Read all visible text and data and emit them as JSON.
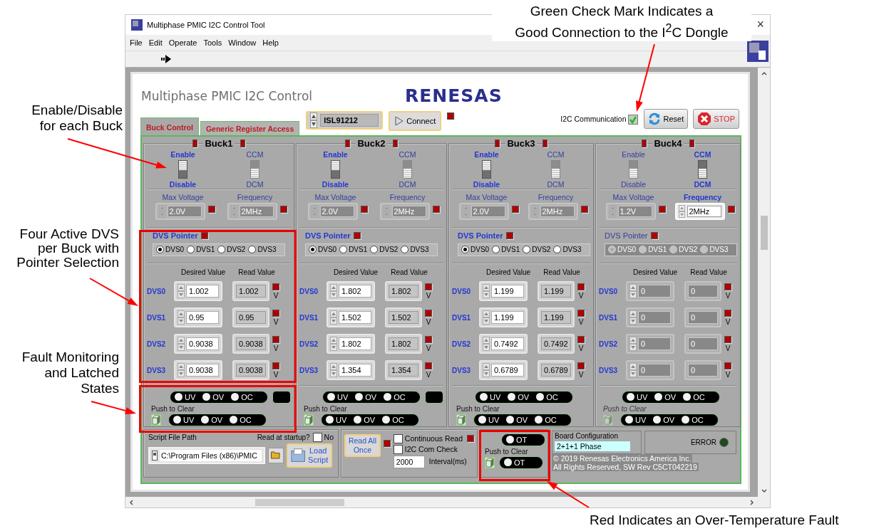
{
  "window": {
    "title": "Multiphase PMIC I2C Control Tool",
    "close": "×"
  },
  "menu": [
    "File",
    "Edit",
    "Operate",
    "Tools",
    "Window",
    "Help"
  ],
  "app": {
    "title": "Multiphase PMIC I2C Control",
    "logo": "RENESAS"
  },
  "tabs": [
    {
      "label": "Buck Control",
      "selected": true
    },
    {
      "label": "Generic Register Access",
      "selected": false
    }
  ],
  "device": {
    "value": "ISL91212"
  },
  "connect": {
    "label": "Connect"
  },
  "i2c": {
    "label": "I2C Communication",
    "checked": true
  },
  "reset": {
    "label": "Reset"
  },
  "stop": {
    "label": "STOP"
  },
  "bucks": [
    {
      "name": "Buck1",
      "switches": [
        {
          "top": "Enable",
          "bottom": "Disable",
          "on": true,
          "disabled": false
        },
        {
          "top": "CCM",
          "bottom": "DCM",
          "on": false,
          "disabled": true
        }
      ],
      "settings": [
        {
          "label": "Max Voltage",
          "value": "2.0V",
          "disabled": true
        },
        {
          "label": "Frequency",
          "value": "2MHz",
          "disabled": true
        }
      ],
      "dvs_pointer": {
        "label": "DVS Pointer",
        "disabled": false,
        "options": [
          {
            "label": "DVS0",
            "selected": true
          },
          {
            "label": "DVS1",
            "selected": false
          },
          {
            "label": "DVS2",
            "selected": false
          },
          {
            "label": "DVS3",
            "selected": false
          }
        ]
      },
      "dvs_table": {
        "disabled": false,
        "columns": [
          "Desired Value",
          "Read Value"
        ],
        "rows": [
          {
            "label": "DVS0",
            "desired": "1.002",
            "read": "1.002",
            "unit": "V"
          },
          {
            "label": "DVS1",
            "desired": "0.95",
            "read": "0.95",
            "unit": "V"
          },
          {
            "label": "DVS2",
            "desired": "0.9038",
            "read": "0.9038",
            "unit": "V"
          },
          {
            "label": "DVS3",
            "desired": "0.9038",
            "read": "0.9038",
            "unit": "V"
          }
        ]
      },
      "faults": {
        "push_to_clear": "Push to Clear",
        "disabled": false,
        "extra_indicator": true,
        "live": [
          {
            "label": "UV",
            "lit": false
          },
          {
            "label": "OV",
            "lit": false
          },
          {
            "label": "OC",
            "lit": false
          }
        ],
        "latched": [
          {
            "label": "UV",
            "lit": false
          },
          {
            "label": "OV",
            "lit": false
          },
          {
            "label": "OC",
            "lit": false
          }
        ]
      }
    },
    {
      "name": "Buck2",
      "switches": [
        {
          "top": "Enable",
          "bottom": "Disable",
          "on": true,
          "disabled": false
        },
        {
          "top": "CCM",
          "bottom": "DCM",
          "on": false,
          "disabled": true
        }
      ],
      "settings": [
        {
          "label": "Max Voltage",
          "value": "2.0V",
          "disabled": true
        },
        {
          "label": "Frequency",
          "value": "2MHz",
          "disabled": true
        }
      ],
      "dvs_pointer": {
        "label": "DVS Pointer",
        "disabled": false,
        "options": [
          {
            "label": "DVS0",
            "selected": true
          },
          {
            "label": "DVS1",
            "selected": false
          },
          {
            "label": "DVS2",
            "selected": false
          },
          {
            "label": "DVS3",
            "selected": false
          }
        ]
      },
      "dvs_table": {
        "disabled": false,
        "columns": [
          "Desired Value",
          "Read Value"
        ],
        "rows": [
          {
            "label": "DVS0",
            "desired": "1.802",
            "read": "1.802",
            "unit": "V"
          },
          {
            "label": "DVS1",
            "desired": "1.502",
            "read": "1.502",
            "unit": "V"
          },
          {
            "label": "DVS2",
            "desired": "1.802",
            "read": "1.802",
            "unit": "V"
          },
          {
            "label": "DVS3",
            "desired": "1.354",
            "read": "1.354",
            "unit": "V"
          }
        ]
      },
      "faults": {
        "push_to_clear": "Push to Clear",
        "disabled": false,
        "extra_indicator": true,
        "live": [
          {
            "label": "UV",
            "lit": false
          },
          {
            "label": "OV",
            "lit": false
          },
          {
            "label": "OC",
            "lit": false
          }
        ],
        "latched": [
          {
            "label": "UV",
            "lit": false
          },
          {
            "label": "OV",
            "lit": false
          },
          {
            "label": "OC",
            "lit": false
          }
        ]
      }
    },
    {
      "name": "Buck3",
      "switches": [
        {
          "top": "Enable",
          "bottom": "Disable",
          "on": true,
          "disabled": false
        },
        {
          "top": "CCM",
          "bottom": "DCM",
          "on": false,
          "disabled": true
        }
      ],
      "settings": [
        {
          "label": "Max Voltage",
          "value": "2.0V",
          "disabled": true
        },
        {
          "label": "Frequency",
          "value": "2MHz",
          "disabled": true
        }
      ],
      "dvs_pointer": {
        "label": "DVS Pointer",
        "disabled": false,
        "options": [
          {
            "label": "DVS0",
            "selected": true
          },
          {
            "label": "DVS1",
            "selected": false
          },
          {
            "label": "DVS2",
            "selected": false
          },
          {
            "label": "DVS3",
            "selected": false
          }
        ]
      },
      "dvs_table": {
        "disabled": false,
        "columns": [
          "Desired Value",
          "Read Value"
        ],
        "rows": [
          {
            "label": "DVS0",
            "desired": "1.199",
            "read": "1.199",
            "unit": "V"
          },
          {
            "label": "DVS1",
            "desired": "1.199",
            "read": "1.199",
            "unit": "V"
          },
          {
            "label": "DVS2",
            "desired": "0.7492",
            "read": "0.7492",
            "unit": "V"
          },
          {
            "label": "DVS3",
            "desired": "0.6789",
            "read": "0.6789",
            "unit": "V"
          }
        ]
      },
      "faults": {
        "push_to_clear": "Push to Clear",
        "disabled": false,
        "extra_indicator": false,
        "live": [
          {
            "label": "UV",
            "lit": false
          },
          {
            "label": "OV",
            "lit": false
          },
          {
            "label": "OC",
            "lit": false
          }
        ],
        "latched": [
          {
            "label": "UV",
            "lit": false
          },
          {
            "label": "OV",
            "lit": false
          },
          {
            "label": "OC",
            "lit": false
          }
        ]
      }
    },
    {
      "name": "Buck4",
      "switches": [
        {
          "top": "Enable",
          "bottom": "Disable",
          "on": false,
          "disabled": true
        },
        {
          "top": "CCM",
          "bottom": "DCM",
          "on": false,
          "disabled": false
        }
      ],
      "settings": [
        {
          "label": "Max Voltage",
          "value": "1.2V",
          "disabled": true
        },
        {
          "label": "Frequency",
          "value": "2MHz",
          "disabled": false
        }
      ],
      "dvs_pointer": {
        "label": "DVS Pointer",
        "disabled": true,
        "options": [
          {
            "label": "DVS0",
            "selected": true
          },
          {
            "label": "DVS1",
            "selected": false
          },
          {
            "label": "DVS2",
            "selected": false
          },
          {
            "label": "DVS3",
            "selected": false
          }
        ]
      },
      "dvs_table": {
        "disabled": true,
        "columns": [
          "Desired Value",
          "Read Value"
        ],
        "rows": [
          {
            "label": "DVS0",
            "desired": "0",
            "read": "0",
            "unit": "V"
          },
          {
            "label": "DVS1",
            "desired": "0",
            "read": "0",
            "unit": "V"
          },
          {
            "label": "DVS2",
            "desired": "0",
            "read": "0",
            "unit": "V"
          },
          {
            "label": "DVS3",
            "desired": "0",
            "read": "0",
            "unit": "V"
          }
        ]
      },
      "faults": {
        "push_to_clear": "Push to Clear",
        "disabled": true,
        "extra_indicator": false,
        "live": [
          {
            "label": "UV",
            "lit": false
          },
          {
            "label": "OV",
            "lit": false
          },
          {
            "label": "OC",
            "lit": false
          }
        ],
        "latched": [
          {
            "label": "UV",
            "lit": false
          },
          {
            "label": "OV",
            "lit": false
          },
          {
            "label": "OC",
            "lit": false
          }
        ]
      }
    }
  ],
  "script": {
    "label": "Script File Path",
    "startup_label": "Read at startup?",
    "startup": {
      "label": "No",
      "checked": false
    },
    "path": "C:\\Program Files (x86)\\PMIC",
    "load": "Load Script"
  },
  "read": {
    "read_all": "Read All Once",
    "continuous": {
      "label": "Continuous Read",
      "checked": false
    },
    "com_check": {
      "label": "I2C Com Check",
      "checked": false
    },
    "interval": {
      "value": "2000",
      "label": "Interval(ms)"
    }
  },
  "ot": {
    "push_to_clear": "Push to Clear",
    "live": {
      "label": "OT",
      "lit": false
    },
    "latched": {
      "label": "OT",
      "lit": false
    }
  },
  "board": {
    "label": "Board Configuration",
    "value": "2+1+1 Phase",
    "error": {
      "label": "ERROR",
      "lit": false
    },
    "copyright": [
      "© 2019 Renesas Electronics America Inc.",
      "All Rights Reserved, SW Rev C5CT042219"
    ]
  },
  "annotations": [
    {
      "lines": [
        "Green Check Mark Indicates a",
        "Good Connection to the I$^{2}$C Dongle"
      ]
    },
    {
      "lines": [
        "Enable/Disable",
        "for each Buck"
      ]
    },
    {
      "lines": [
        "Four Active DVS",
        "per Buck with",
        "Pointer Selection"
      ]
    },
    {
      "lines": [
        "Fault Monitoring",
        "and Latched",
        "States"
      ]
    },
    {
      "lines": [
        "Red Indicates an Over-Temperature Fault"
      ]
    }
  ]
}
